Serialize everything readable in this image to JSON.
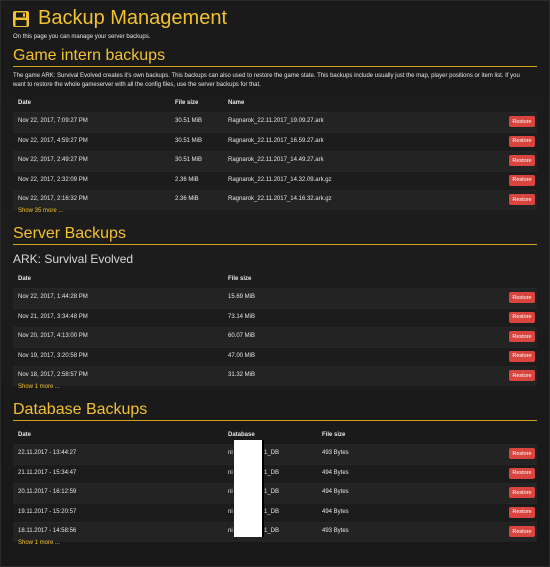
{
  "header": {
    "title": "Backup Management",
    "intro": "On this page you can manage your server backups."
  },
  "game_backups": {
    "title": "Game intern backups",
    "description": "The game ARK: Survival Evolved creates it's own backups. This backups can also used to restore the game state. This backups include usually just the map, player positions or item list. If you want to restore the whole gameserver with all the config files, use the server backups for that.",
    "headers": {
      "date": "Date",
      "size": "File size",
      "name": "Name"
    },
    "rows": [
      {
        "date": "Nov 22, 2017, 7:09:27 PM",
        "size": "30.51 MiB",
        "name": "Ragnarok_22.11.2017_19.09.27.ark",
        "action": "Restore"
      },
      {
        "date": "Nov 22, 2017, 4:59:27 PM",
        "size": "30.51 MiB",
        "name": "Ragnarok_22.11.2017_16.59.27.ark",
        "action": "Restore"
      },
      {
        "date": "Nov 22, 2017, 2:49:27 PM",
        "size": "30.51 MiB",
        "name": "Ragnarok_22.11.2017_14.49.27.ark",
        "action": "Restore"
      },
      {
        "date": "Nov 22, 2017, 2:32:09 PM",
        "size": "2.36 MiB",
        "name": "Ragnarok_22.11.2017_14.32.09.ark.gz",
        "action": "Restore"
      },
      {
        "date": "Nov 22, 2017, 2:16:32 PM",
        "size": "2.36 MiB",
        "name": "Ragnarok_22.11.2017_14.16.32.ark.gz",
        "action": "Restore"
      }
    ],
    "show_more": "Show 35 more ..."
  },
  "server_backups": {
    "title": "Server Backups",
    "subtitle": "ARK: Survival Evolved",
    "headers": {
      "date": "Date",
      "size": "File size"
    },
    "rows": [
      {
        "date": "Nov 22, 2017, 1:44:28 PM",
        "size": "15.69 MiB",
        "action": "Restore"
      },
      {
        "date": "Nov 21, 2017, 3:34:48 PM",
        "size": "73.14 MiB",
        "action": "Restore"
      },
      {
        "date": "Nov 20, 2017, 4:13:00 PM",
        "size": "60.07 MiB",
        "action": "Restore"
      },
      {
        "date": "Nov 19, 2017, 3:20:58 PM",
        "size": "47.00 MiB",
        "action": "Restore"
      },
      {
        "date": "Nov 18, 2017, 2:58:57 PM",
        "size": "31.32 MiB",
        "action": "Restore"
      }
    ],
    "show_more": "Show 1 more ..."
  },
  "database_backups": {
    "title": "Database Backups",
    "headers": {
      "date": "Date",
      "database": "Database",
      "size": "File size"
    },
    "rows": [
      {
        "date": "22.11.2017 - 13:44:27",
        "db_prefix": "ni",
        "db_suffix": "1_DB",
        "size": "493 Bytes",
        "action": "Restore"
      },
      {
        "date": "21.11.2017 - 15:34:47",
        "db_prefix": "ni",
        "db_suffix": "1_DB",
        "size": "494 Bytes",
        "action": "Restore"
      },
      {
        "date": "20.11.2017 - 16:12:59",
        "db_prefix": "ni",
        "db_suffix": "1_DB",
        "size": "494 Bytes",
        "action": "Restore"
      },
      {
        "date": "19.11.2017 - 15:20:57",
        "db_prefix": "ni",
        "db_suffix": "1_DB",
        "size": "494 Bytes",
        "action": "Restore"
      },
      {
        "date": "18.11.2017 - 14:58:56",
        "db_prefix": "ni",
        "db_suffix": "1_DB",
        "size": "493 Bytes",
        "action": "Restore"
      }
    ],
    "show_more": "Show 1 more ..."
  },
  "colors": {
    "accent": "#f2c12e",
    "danger": "#d9443f",
    "background": "#1a1a1a"
  },
  "icons": {
    "title": "floppy-disk-icon"
  }
}
